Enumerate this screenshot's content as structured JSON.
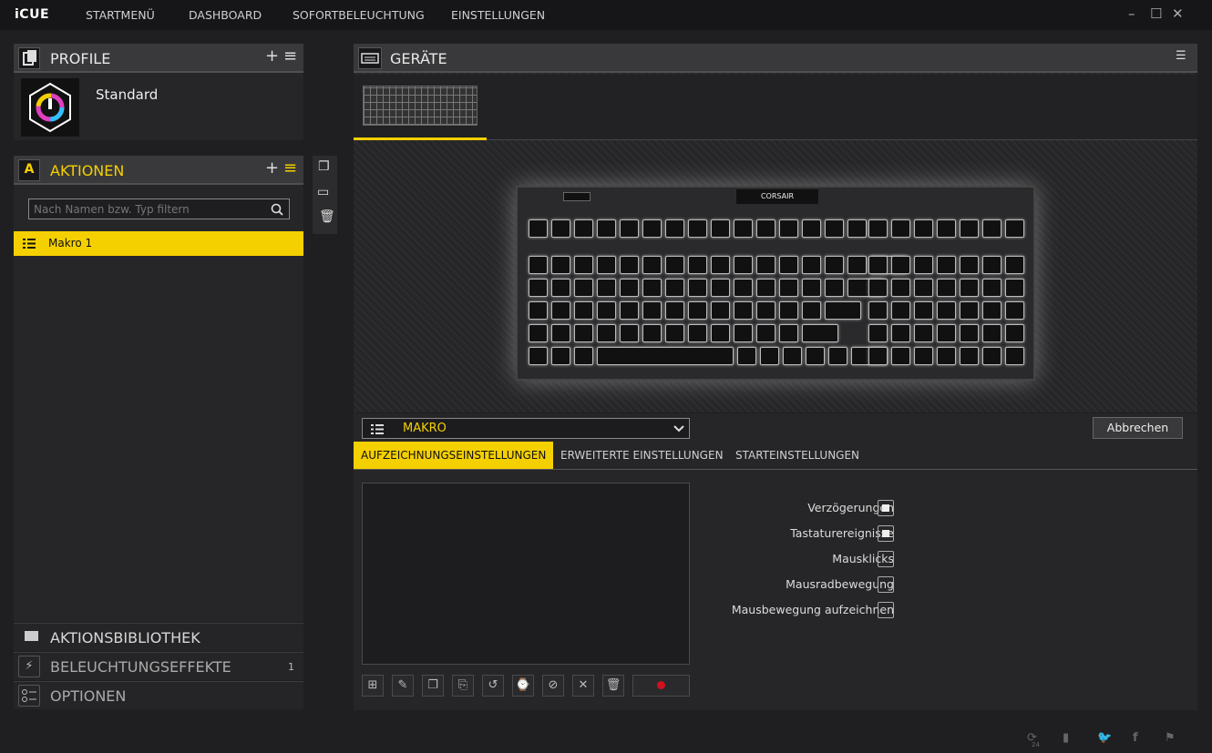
{
  "app": {
    "logo": "iCUE"
  },
  "nav": [
    "STARTMENÜ",
    "DASHBOARD",
    "SOFORTBELEUCHTUNG",
    "EINSTELLUNGEN"
  ],
  "window": {
    "minimize": "–",
    "maximize": "☐",
    "close": "✕"
  },
  "profile": {
    "title": "PROFILE",
    "name": "Standard"
  },
  "actions": {
    "title": "AKTIONEN",
    "filter_placeholder": "Nach Namen bzw. Typ filtern",
    "items": [
      "Makro 1"
    ]
  },
  "bottom": {
    "library": "AKTIONSBIBLIOTHEK",
    "effects": "BELEUCHTUNGSEFFEKTE",
    "effects_count": "1",
    "options": "OPTIONEN"
  },
  "devices": {
    "title": "GERÄTE",
    "brand": "CORSAIR"
  },
  "macro": {
    "type": "MAKRO",
    "cancel": "Abbrechen",
    "tabs": [
      "AUFZEICHNUNGSEINSTELLUNGEN",
      "ERWEITERTE EINSTELLUNGEN",
      "STARTEINSTELLUNGEN"
    ],
    "options": [
      {
        "label": "Verzögerungen",
        "checked": true
      },
      {
        "label": "Tastaturereignisse",
        "checked": true
      },
      {
        "label": "Mausklicks",
        "checked": false
      },
      {
        "label": "Mausradbewegung",
        "checked": false
      },
      {
        "label": "Mausbewegung aufzeichnen",
        "checked": false
      }
    ]
  },
  "footer": {
    "counter": "24"
  },
  "colors": {
    "accent": "#f5d000",
    "bg": "#1f1f21"
  }
}
